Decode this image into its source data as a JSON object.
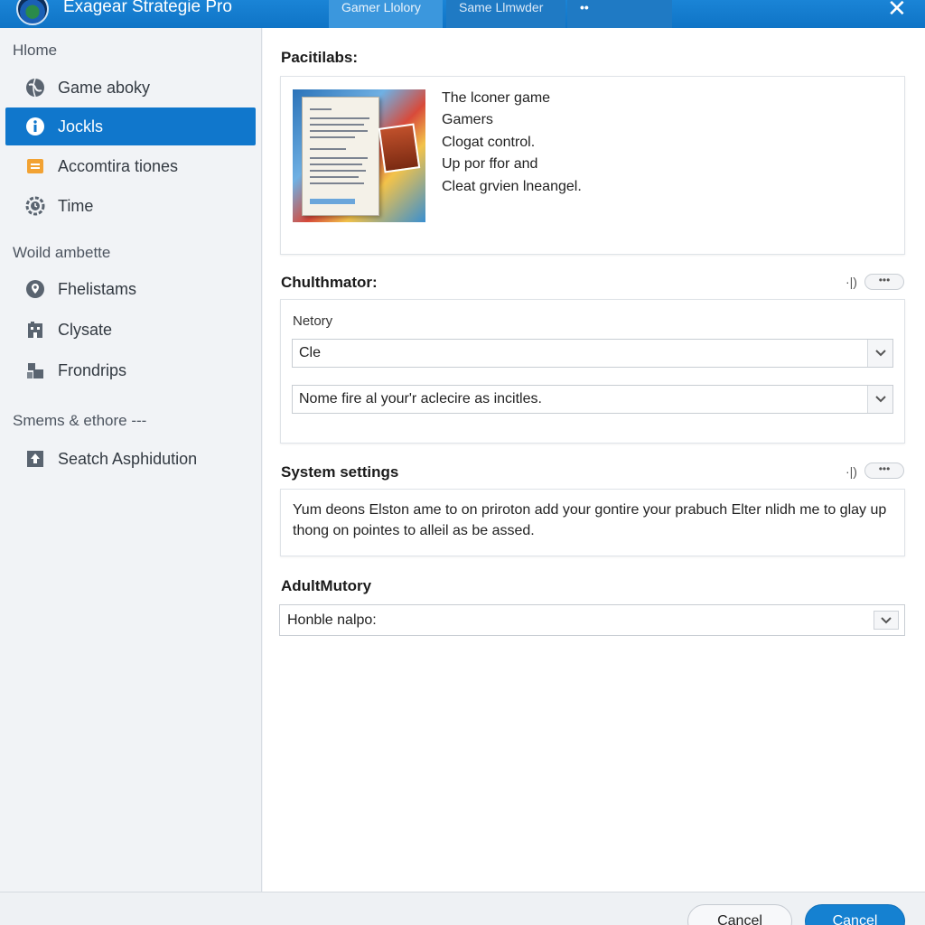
{
  "window": {
    "title": "Exagear Strategie Pro",
    "tabs": [
      "Gamer Llolory",
      "Same Llmwder",
      "••"
    ],
    "close_glyph": "✕"
  },
  "sidebar": {
    "sections": [
      {
        "heading": "Hlome",
        "items": [
          {
            "label": "Game aboky",
            "icon": "globe-icon"
          },
          {
            "label": "Jockls",
            "icon": "info-icon",
            "active": true
          },
          {
            "label": "Accomtira tiones",
            "icon": "list-icon"
          },
          {
            "label": "Time",
            "icon": "clock-gear-icon"
          }
        ]
      },
      {
        "heading": "Woild ambette",
        "items": [
          {
            "label": "Fhelistams",
            "icon": "map-pin-icon"
          },
          {
            "label": "Clysate",
            "icon": "building-icon"
          },
          {
            "label": "Frondrips",
            "icon": "people-icon"
          }
        ]
      },
      {
        "heading": "Smems & ethore ---",
        "items": [
          {
            "label": "Seatch Asphidution",
            "icon": "upload-icon"
          }
        ]
      }
    ]
  },
  "main": {
    "section1": {
      "heading": "Pacitilabs:",
      "lines": [
        "The lconer game",
        "Gamers",
        "Clogat control.",
        "Up por ffor and",
        "Cleat grvien lneangel."
      ]
    },
    "section2": {
      "heading": "Chulthmator:",
      "mini_label": "·|)",
      "pill_label": "•••",
      "field_label": "Netory",
      "select1_value": "Cle",
      "select2_value": "Nome fire al your'r aclecire as incitles."
    },
    "section3": {
      "heading": "System settings",
      "mini_label": "·|)",
      "pill_label": "•••",
      "text_line1": "Yum deons Elston ame to on priroton add your gontire your prabuch Elter nlidh me to glay up",
      "text_line2": "thong on pointes to alleil as be assed."
    },
    "section4": {
      "heading": "AdultMutory",
      "select_value": "Honble nalpo:"
    }
  },
  "footer": {
    "cancel_label": "Cancel",
    "primary_label": "Cancel"
  },
  "colors": {
    "titlebar": "#1479c8",
    "accent": "#1077cc",
    "primary_button": "#1581d1"
  }
}
